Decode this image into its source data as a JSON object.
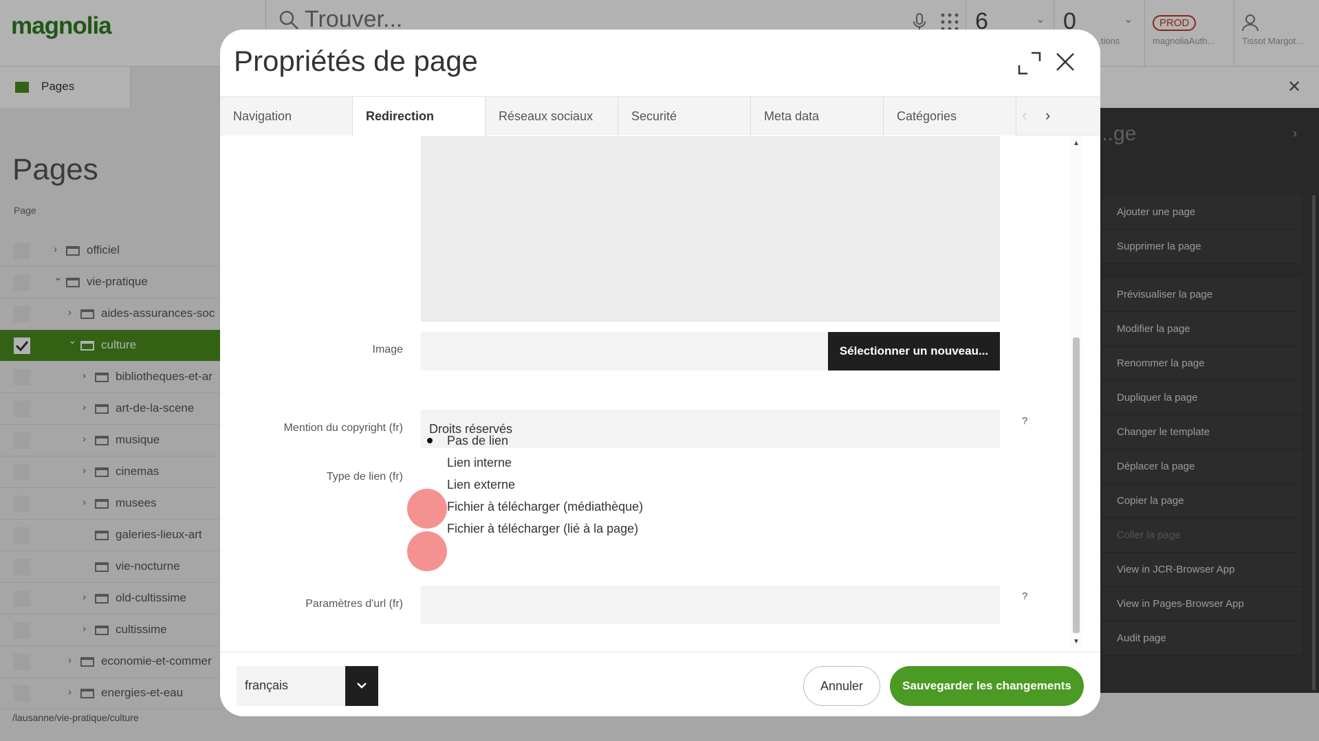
{
  "app": {
    "logo": "magnolia",
    "search": {
      "placeholder": "Trouver..."
    },
    "tasks_count": "6",
    "notifications_count": "0",
    "notifications_label": "...tions",
    "env_badge": "PROD",
    "env_user": "magnoliaAuth...",
    "user_name": "Tissot Margot..."
  },
  "left": {
    "app_tab": "Pages",
    "heading": "Pages",
    "column_header": "Page",
    "tree": [
      {
        "label": "officiel",
        "depth": 1,
        "expandable": true,
        "expanded": false,
        "selected": false
      },
      {
        "label": "vie-pratique",
        "depth": 1,
        "expandable": true,
        "expanded": true,
        "selected": false
      },
      {
        "label": "aides-assurances-soc",
        "depth": 2,
        "expandable": true,
        "expanded": false,
        "selected": false
      },
      {
        "label": "culture",
        "depth": 2,
        "expandable": true,
        "expanded": true,
        "selected": true
      },
      {
        "label": "bibliotheques-et-ar",
        "depth": 3,
        "expandable": true,
        "expanded": false,
        "selected": false
      },
      {
        "label": "art-de-la-scene",
        "depth": 3,
        "expandable": true,
        "expanded": false,
        "selected": false
      },
      {
        "label": "musique",
        "depth": 3,
        "expandable": true,
        "expanded": false,
        "selected": false
      },
      {
        "label": "cinemas",
        "depth": 3,
        "expandable": true,
        "expanded": false,
        "selected": false
      },
      {
        "label": "musees",
        "depth": 3,
        "expandable": true,
        "expanded": false,
        "selected": false
      },
      {
        "label": "galeries-lieux-art",
        "depth": 3,
        "expandable": false,
        "expanded": false,
        "selected": false
      },
      {
        "label": "vie-nocturne",
        "depth": 3,
        "expandable": false,
        "expanded": false,
        "selected": false
      },
      {
        "label": "old-cultissime",
        "depth": 3,
        "expandable": true,
        "expanded": false,
        "selected": false
      },
      {
        "label": "cultissime",
        "depth": 3,
        "expandable": true,
        "expanded": false,
        "selected": false
      },
      {
        "label": "economie-et-commer",
        "depth": 2,
        "expandable": true,
        "expanded": false,
        "selected": false
      },
      {
        "label": "energies-et-eau",
        "depth": 2,
        "expandable": true,
        "expanded": false,
        "selected": false
      }
    ],
    "status_path": "/lausanne/vie-pratique/culture"
  },
  "actions": {
    "title": "...ge",
    "items": [
      {
        "label": "Ajouter une page",
        "disabled": false,
        "gap_after": false
      },
      {
        "label": "Supprimer la page",
        "disabled": false,
        "gap_after": true
      },
      {
        "label": "Prévisualiser la page",
        "disabled": false,
        "gap_after": false
      },
      {
        "label": "Modifier la page",
        "disabled": false,
        "gap_after": false
      },
      {
        "label": "Renommer la page",
        "disabled": false,
        "gap_after": false
      },
      {
        "label": "Dupliquer la page",
        "disabled": false,
        "gap_after": false
      },
      {
        "label": "Changer le template",
        "disabled": false,
        "gap_after": false
      },
      {
        "label": "Déplacer la page",
        "disabled": false,
        "gap_after": false
      },
      {
        "label": "Copier la page",
        "disabled": false,
        "gap_after": false
      },
      {
        "label": "Coller la page",
        "disabled": true,
        "gap_after": false
      },
      {
        "label": "View in JCR-Browser App",
        "disabled": false,
        "gap_after": false
      },
      {
        "label": "View in Pages-Browser App",
        "disabled": false,
        "gap_after": false
      },
      {
        "label": "Audit page",
        "disabled": false,
        "gap_after": false
      }
    ]
  },
  "dialog": {
    "title": "Propriétés de page",
    "tabs": [
      {
        "label": "Navigation",
        "active": false
      },
      {
        "label": "Redirection",
        "active": true
      },
      {
        "label": "Réseaux sociaux",
        "active": false
      },
      {
        "label": "Securité",
        "active": false
      },
      {
        "label": "Meta data",
        "active": false
      },
      {
        "label": "Catégories",
        "active": false
      }
    ],
    "fields": {
      "image_label": "Image",
      "image_button": "Sélectionner un nouveau...",
      "copyright_label": "Mention du copyright (fr)",
      "copyright_value": "Droits réservés",
      "copyright_help": "?",
      "link_type_label": "Type de lien (fr)",
      "link_type_options": [
        {
          "label": "Pas de lien",
          "checked": true
        },
        {
          "label": "Lien interne",
          "checked": false
        },
        {
          "label": "Lien externe",
          "checked": false
        },
        {
          "label": "Fichier à télécharger (médiathèque)",
          "checked": false
        },
        {
          "label": "Fichier à télécharger (lié à la page)",
          "checked": false
        }
      ],
      "url_params_label": "Paramètres d'url (fr)",
      "url_params_value": "",
      "url_params_help": "?"
    },
    "footer": {
      "language": "français",
      "cancel": "Annuler",
      "save": "Sauvegarder les changements"
    }
  },
  "colors": {
    "brand_green": "#4a9a23",
    "tree_selected": "#4a8d1f",
    "dark_button": "#1f1f1f",
    "click_marker": "#f06e6e"
  }
}
